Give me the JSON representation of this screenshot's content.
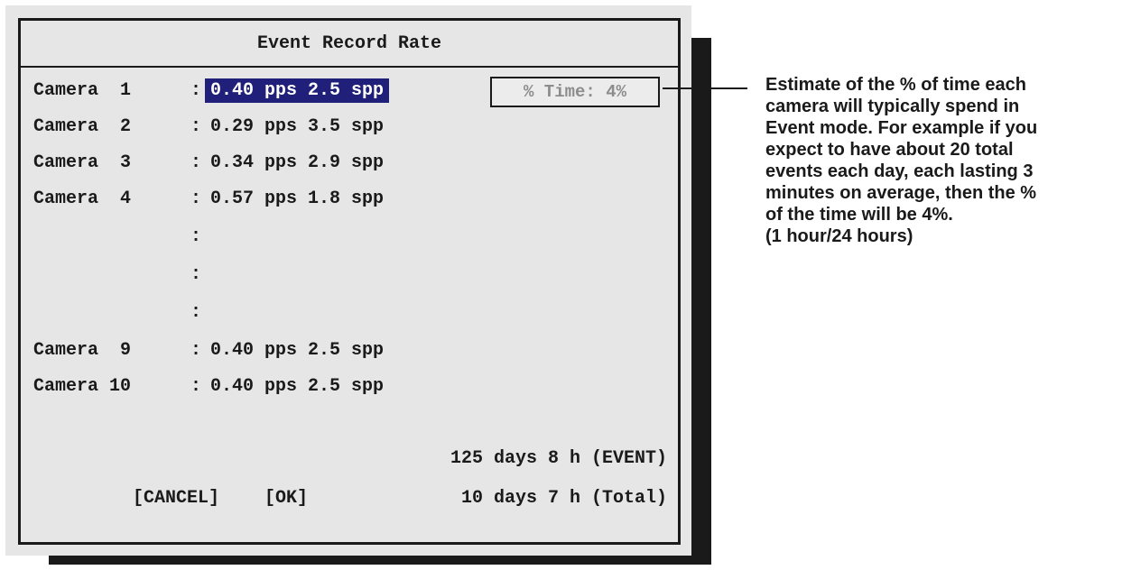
{
  "dialog": {
    "title": "Event Record Rate",
    "percent_time": "% Time: 4%",
    "cameras": [
      {
        "label": "Camera  1",
        "rate": "0.40 pps 2.5 spp",
        "selected": true
      },
      {
        "label": "Camera  2",
        "rate": "0.29 pps 3.5 spp",
        "selected": false
      },
      {
        "label": "Camera  3",
        "rate": "0.34 pps 2.9 spp",
        "selected": false
      },
      {
        "label": "Camera  4",
        "rate": "0.57 pps 1.8 spp",
        "selected": false
      },
      {
        "label": "Camera  9",
        "rate": "0.40 pps 2.5 spp",
        "selected": false
      },
      {
        "label": "Camera 10",
        "rate": "0.40 pps 2.5 spp",
        "selected": false
      }
    ],
    "separator": ":",
    "event_duration": "125 days 8 h (EVENT)",
    "total_duration": "10 days 7 h (Total)",
    "cancel_label": "[CANCEL]",
    "ok_label": "[OK]"
  },
  "annotation": {
    "lines": [
      "Estimate of the % of time each",
      "camera will typically spend in",
      "Event mode. For example if you",
      "expect to have about 20 total",
      "events each day, each lasting 3",
      "minutes on average, then the %",
      "of the time will be 4%.",
      "(1 hour/24 hours)"
    ]
  }
}
